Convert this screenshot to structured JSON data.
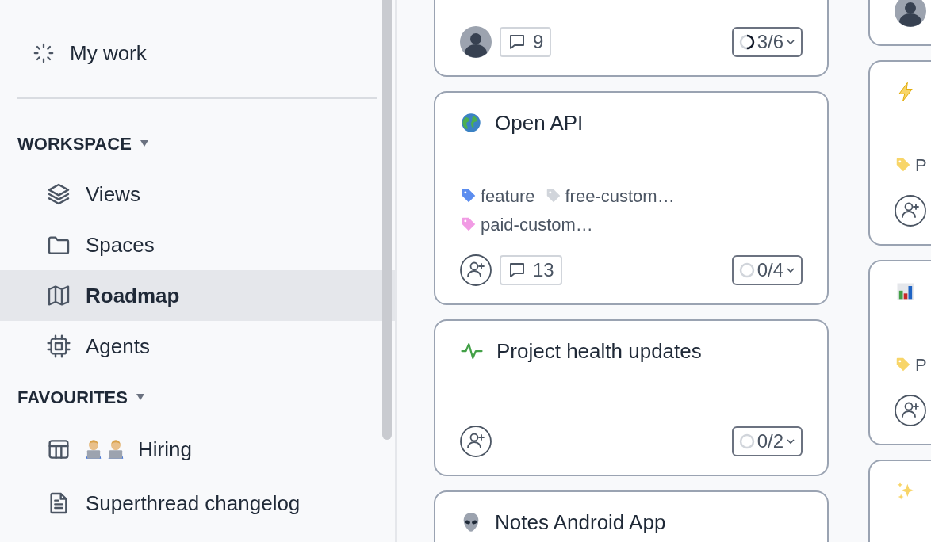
{
  "sidebar": {
    "top_items": [
      {
        "label": "My work",
        "selected": false
      }
    ],
    "sections": [
      {
        "heading": "WORKSPACE",
        "expanded": true,
        "items": [
          {
            "label": "Views",
            "selected": false
          },
          {
            "label": "Spaces",
            "selected": false
          },
          {
            "label": "Roadmap",
            "selected": true
          },
          {
            "label": "Agents",
            "selected": false
          }
        ]
      },
      {
        "heading": "FAVOURITES",
        "expanded": true,
        "items": [
          {
            "label": "Hiring",
            "selected": false
          },
          {
            "label": "Superthread changelog",
            "selected": false
          }
        ]
      }
    ]
  },
  "board": {
    "columns": [
      {
        "cards": [
          {
            "kind": "card",
            "assignee": {
              "kind": "avatar"
            },
            "comments": "9",
            "progress": {
              "text": "3/6"
            }
          },
          {
            "kind": "card",
            "title": "Open API",
            "tags": [
              {
                "label": "feature",
                "color": "#5b8def"
              },
              {
                "label": "free-custom…",
                "color": "#d1d5db"
              },
              {
                "label": "paid-custom…",
                "color": "#f19be4"
              }
            ],
            "assignee": {
              "kind": "add"
            },
            "comments": "13",
            "progress": {
              "text": "0/4"
            }
          },
          {
            "kind": "card",
            "title": "Project health updates",
            "assignee": {
              "kind": "add"
            },
            "progress": {
              "text": "0/2"
            }
          },
          {
            "kind": "card",
            "title": "Notes Android App"
          }
        ]
      },
      {
        "cards": [
          {
            "kind": "card",
            "assignee": {
              "kind": "avatar"
            }
          },
          {
            "kind": "card",
            "tags": [
              {
                "label": "P",
                "color": "#f8d568"
              }
            ],
            "assignee": {
              "kind": "add"
            }
          },
          {
            "kind": "card",
            "tags": [
              {
                "label": "P",
                "color": "#f8d568"
              }
            ],
            "assignee": {
              "kind": "add"
            }
          },
          {
            "kind": "cut-off"
          }
        ]
      }
    ]
  }
}
